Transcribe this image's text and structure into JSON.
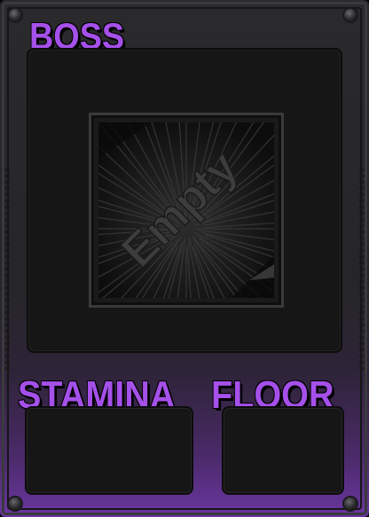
{
  "card": {
    "boss_label": "BOSS",
    "stamina_label": "STAMINA",
    "floor_label": "FLOOR"
  },
  "boss_slot": {
    "placeholder_text": "Empty"
  },
  "colors": {
    "label": "#a550ea",
    "frame_bottom_glow": "#6a36a0",
    "panel_bg": "#161616"
  }
}
